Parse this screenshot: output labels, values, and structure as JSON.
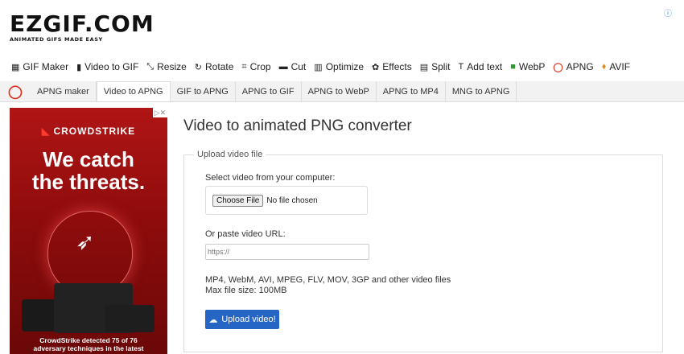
{
  "logo": {
    "main": "EZGIF.COM",
    "tagline": "ANIMATED GIFS MADE EASY"
  },
  "adchoices_icon": "adchoices-icon",
  "main_nav": [
    {
      "label": "GIF Maker",
      "icon": "gif-maker-icon"
    },
    {
      "label": "Video to GIF",
      "icon": "video-icon"
    },
    {
      "label": "Resize",
      "icon": "resize-icon"
    },
    {
      "label": "Rotate",
      "icon": "rotate-icon"
    },
    {
      "label": "Crop",
      "icon": "crop-icon"
    },
    {
      "label": "Cut",
      "icon": "cut-icon"
    },
    {
      "label": "Optimize",
      "icon": "optimize-icon"
    },
    {
      "label": "Effects",
      "icon": "effects-icon"
    },
    {
      "label": "Split",
      "icon": "split-icon"
    },
    {
      "label": "Add text",
      "icon": "add-text-icon"
    },
    {
      "label": "WebP",
      "icon": "webp-icon"
    },
    {
      "label": "APNG",
      "icon": "apng-icon",
      "active": true
    },
    {
      "label": "AVIF",
      "icon": "avif-icon"
    }
  ],
  "sub_nav": [
    {
      "label": "APNG maker"
    },
    {
      "label": "Video to APNG",
      "active": true
    },
    {
      "label": "GIF to APNG"
    },
    {
      "label": "APNG to GIF"
    },
    {
      "label": "APNG to WebP"
    },
    {
      "label": "APNG to MP4"
    },
    {
      "label": "MNG to APNG"
    }
  ],
  "ad": {
    "brand": "CROWDSTRIKE",
    "headline_line1": "We catch",
    "headline_line2": "the threats.",
    "footer_line1": "CrowdStrike detected 75 of 76",
    "footer_line2": "adversary techniques in the latest"
  },
  "page": {
    "title": "Video to animated PNG converter",
    "legend": "Upload video file",
    "select_label": "Select video from your computer:",
    "choose_file": "Choose File",
    "no_file": "No file chosen",
    "url_label": "Or paste video URL:",
    "url_placeholder": "https://",
    "formats": "MP4, WebM, AVI, MPEG, FLV, MOV, 3GP and other video files",
    "max_size": "Max file size: 100MB",
    "upload_button": "Upload video!"
  },
  "colors": {
    "accent": "#2566c4",
    "apng_red": "#e0301e",
    "ad_bg": "#8f0c0c"
  }
}
